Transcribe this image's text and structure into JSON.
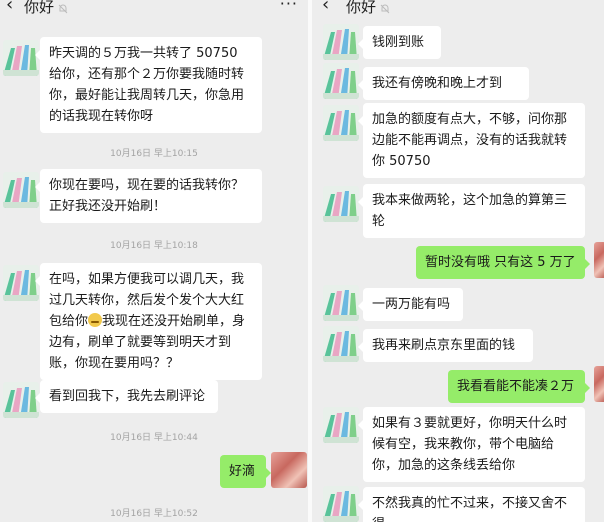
{
  "left": {
    "title": "你好",
    "messages": [
      "昨天调的５万我一共转了 50750 给你，还有那个２万你要我随时转你，最好能让我周转几天，你急用的话我现在转你呀",
      "你现在要吗，现在要的话我转你？正好我还没开始刷！",
      "在吗，如果方便我可以调几天，我过几天转你，然后发个发个大大红包给你",
      "我现在还没开始刷单，身边有，刷单了就要等到明天才到账，你现在要用吗？？",
      "看到回我下，我先去刷评论",
      "好滴"
    ],
    "timestamps": [
      "10月16日 早上10:15",
      "10月16日 早上10:18",
      "10月16日 早上10:44",
      "10月16日 早上10:52"
    ]
  },
  "right": {
    "title": "你好",
    "messages": [
      "钱刚到账",
      "我还有傍晚和晚上才到",
      "加急的额度有点大，不够，问你那边能不能再调点，没有的话我就转你 50750",
      "我本来做两轮，这个加急的算第三轮",
      "暂时没有哦  只有这 5 万了",
      "一两万能有吗",
      "我再来刷点京东里面的钱",
      "我看看能不能凑２万",
      "如果有３要就更好，你明天什么时候有空，我来教你，带个电脑给你，加急的这条线丢给你",
      "不然我真的忙不过来，不接又舍不得"
    ]
  },
  "colors": {
    "background": "#ededed",
    "bubble_in": "#ffffff",
    "bubble_out": "#95ec69"
  },
  "icons": [
    "back-arrow-icon",
    "mute-bell-icon",
    "more-dots-icon"
  ]
}
